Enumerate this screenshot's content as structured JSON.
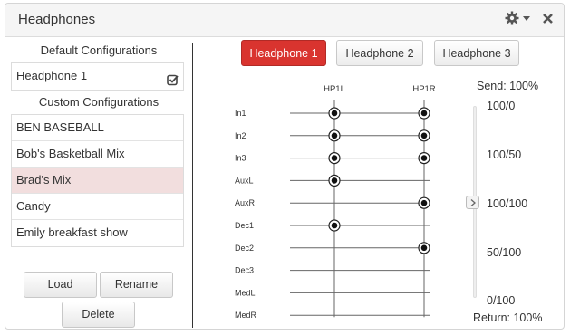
{
  "window": {
    "title": "Headphones",
    "icons": [
      "gear-icon",
      "caret-down-icon",
      "close-icon"
    ]
  },
  "default_section": {
    "title": "Default Configurations",
    "items": [
      {
        "label": "Headphone 1",
        "checked": true
      }
    ]
  },
  "custom_section": {
    "title": "Custom Configurations",
    "items": [
      {
        "label": "BEN BASEBALL",
        "selected": false
      },
      {
        "label": "Bob's Basketball Mix",
        "selected": false
      },
      {
        "label": "Brad's Mix",
        "selected": true
      },
      {
        "label": "Candy",
        "selected": false
      },
      {
        "label": "Emily breakfast show",
        "selected": false
      }
    ]
  },
  "buttons": {
    "load": "Load",
    "rename": "Rename",
    "delete": "Delete"
  },
  "tabs": [
    {
      "label": "Headphone 1",
      "active": true
    },
    {
      "label": "Headphone 2",
      "active": false
    },
    {
      "label": "Headphone 3",
      "active": false
    }
  ],
  "matrix": {
    "columns": [
      "HP1L",
      "HP1R"
    ],
    "rows": [
      {
        "label": "In1",
        "hp1l": true,
        "hp1r": true
      },
      {
        "label": "In2",
        "hp1l": true,
        "hp1r": true
      },
      {
        "label": "In3",
        "hp1l": true,
        "hp1r": true
      },
      {
        "label": "AuxL",
        "hp1l": true,
        "hp1r": false
      },
      {
        "label": "AuxR",
        "hp1l": false,
        "hp1r": true
      },
      {
        "label": "Dec1",
        "hp1l": true,
        "hp1r": false
      },
      {
        "label": "Dec2",
        "hp1l": false,
        "hp1r": true
      },
      {
        "label": "Dec3",
        "hp1l": false,
        "hp1r": false
      },
      {
        "label": "MedL",
        "hp1l": false,
        "hp1r": false
      },
      {
        "label": "MedR",
        "hp1l": false,
        "hp1r": false
      }
    ]
  },
  "slider": {
    "send_label": "Send: 100%",
    "return_label": "Return: 100%",
    "ticks": [
      "100/0",
      "100/50",
      "100/100",
      "50/100",
      "0/100"
    ],
    "value": "100/100"
  },
  "colors": {
    "accent": "#d9342f",
    "selected_row": "#f2dede"
  }
}
